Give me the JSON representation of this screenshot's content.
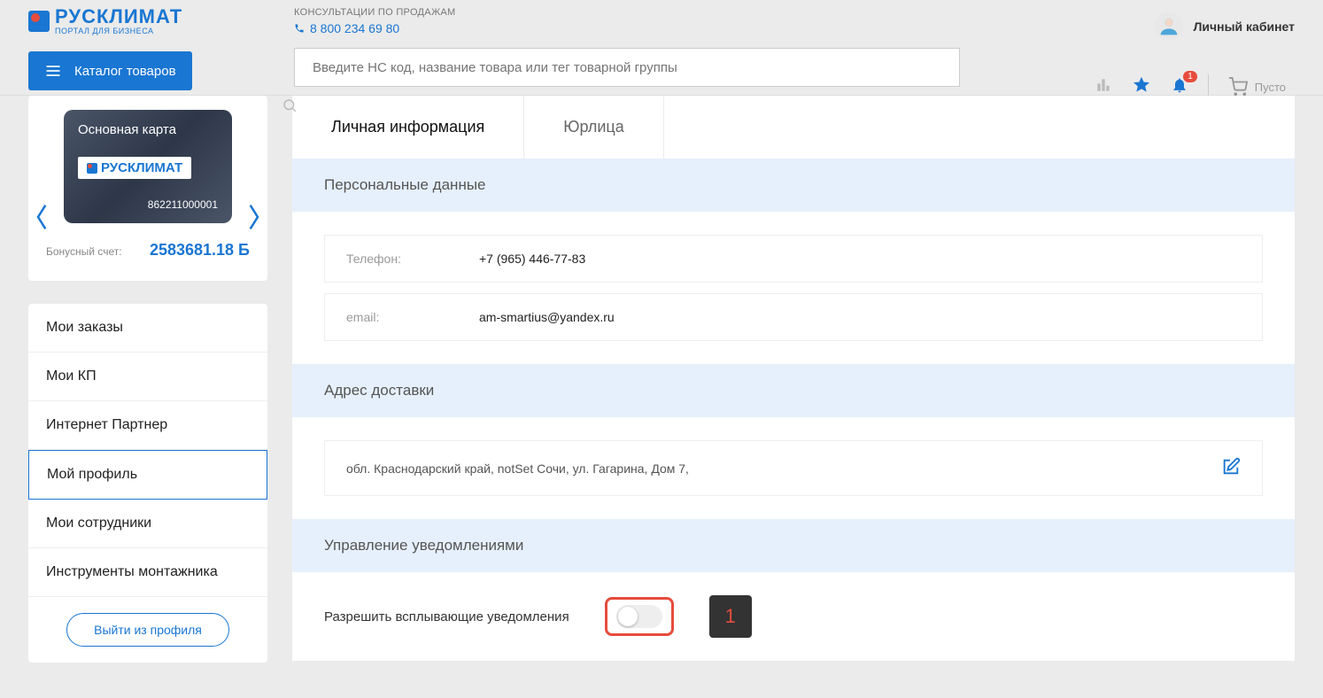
{
  "header": {
    "logo_text": "РУСКЛИМАТ",
    "logo_sub": "ПОРТАЛ ДЛЯ БИЗНЕСА",
    "catalog_btn": "Каталог товаров",
    "consult_label": "КОНСУЛЬТАЦИИ ПО ПРОДАЖАМ",
    "phone": "8 800 234 69 80",
    "search_placeholder": "Введите НС код, название товара или тег товарной группы",
    "account_label": "Личный кабинет",
    "notif_badge": "1",
    "cart_text": "Пусто"
  },
  "card": {
    "title": "Основная карта",
    "brand": "РУСКЛИМАТ",
    "number": "862211000001",
    "bonus_label": "Бонусный счет:",
    "bonus_value": "2583681.18 Б"
  },
  "nav": {
    "items": [
      "Мои заказы",
      "Мои КП",
      "Интернет Партнер",
      "Мой профиль",
      "Мои сотрудники",
      "Инструменты монтажника"
    ],
    "active_index": 3,
    "logout": "Выйти из профиля"
  },
  "tabs": {
    "items": [
      "Личная информация",
      "Юрлица"
    ],
    "active_index": 0
  },
  "sections": {
    "personal": {
      "title": "Персональные данные",
      "phone_label": "Телефон:",
      "phone_value": "+7 (965) 446-77-83",
      "email_label": "email:",
      "email_value": "am-smartius@yandex.ru"
    },
    "address": {
      "title": "Адрес доставки",
      "value": "обл. Краснодарский край, notSet Сочи, ул. Гагарина, Дом 7,"
    },
    "notif": {
      "title": "Управление уведомлениями",
      "allow_label": "Разрешить всплывающие уведомления",
      "step": "1"
    }
  }
}
